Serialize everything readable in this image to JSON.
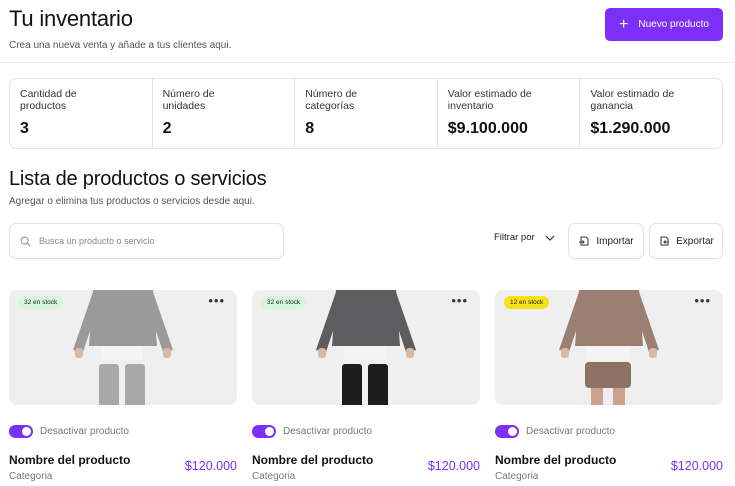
{
  "header": {
    "title": "Tu inventario",
    "subtitle": "Crea una nueva venta y añade a tus clientes aqui.",
    "new_product_label": "Nuevo producto"
  },
  "stats": [
    {
      "label": "Cantidad de productos",
      "value": "3"
    },
    {
      "label": "Número de unidades",
      "value": "2"
    },
    {
      "label": "Número de categorías",
      "value": "8"
    },
    {
      "label": "Valor estimado de inventario",
      "value": "$9.100.000"
    },
    {
      "label": "Valor estimado de ganancia",
      "value": "$1.290.000"
    }
  ],
  "products_section": {
    "title": "Lista de productos o servicios",
    "subtitle": "Agregar o elimina tus productos o servicios desde aqui.",
    "search_placeholder": "Busca un producto o servicio",
    "filter_label": "Filtrar por",
    "import_label": "Importar",
    "export_label": "Exportar"
  },
  "products": [
    {
      "stock": "32 en stock",
      "stock_color": "#d6f5dd",
      "toggle_label": "Desactivar producto",
      "name": "Nombre del producto",
      "category": "Categoria",
      "price": "$120.000",
      "sweater_color": "#9a9a9a",
      "pants_color": "#a8a8a8",
      "pants_type": "pants"
    },
    {
      "stock": "32 en stock",
      "stock_color": "#d6f5dd",
      "toggle_label": "Desactivar producto",
      "name": "Nombre del producto",
      "category": "Categoria",
      "price": "$120.000",
      "sweater_color": "#5d5d5f",
      "pants_color": "#1c1c1c",
      "pants_type": "pants"
    },
    {
      "stock": "12 en stock",
      "stock_color": "#f7e11a",
      "toggle_label": "Desactivar producto",
      "name": "Nombre del producto",
      "category": "Categoria",
      "price": "$120.000",
      "sweater_color": "#9b7f72",
      "pants_color": "#8d7266",
      "pants_type": "shorts"
    }
  ],
  "colors": {
    "accent": "#7b2ff7"
  }
}
